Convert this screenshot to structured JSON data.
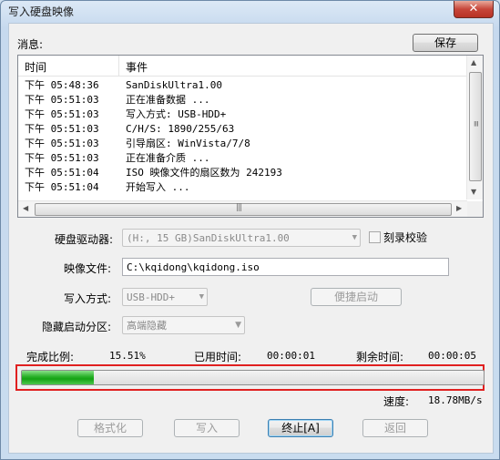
{
  "window": {
    "title": "写入硬盘映像",
    "close_glyph": "✕"
  },
  "log": {
    "label": "消息:",
    "save_label": "保存",
    "columns": [
      "时间",
      "事件"
    ],
    "rows": [
      {
        "time": "下午 05:48:36",
        "event": "SanDiskUltra1.00"
      },
      {
        "time": "下午 05:51:03",
        "event": "正在准备数据 ..."
      },
      {
        "time": "下午 05:51:03",
        "event": "写入方式: USB-HDD+"
      },
      {
        "time": "下午 05:51:03",
        "event": "C/H/S: 1890/255/63"
      },
      {
        "time": "下午 05:51:03",
        "event": "引导扇区: WinVista/7/8"
      },
      {
        "time": "下午 05:51:03",
        "event": "正在准备介质 ..."
      },
      {
        "time": "下午 05:51:04",
        "event": "ISO 映像文件的扇区数为 242193"
      },
      {
        "time": "下午 05:51:04",
        "event": "开始写入 ..."
      }
    ]
  },
  "form": {
    "drive_label": "硬盘驱动器:",
    "drive_value": "(H:, 15 GB)SanDiskUltra1.00",
    "verify_label": "刻录校验",
    "image_label": "映像文件:",
    "image_value": "C:\\kqidong\\kqidong.iso",
    "write_mode_label": "写入方式:",
    "write_mode_value": "USB-HDD+",
    "quick_boot_label": "便捷启动",
    "hidden_part_label": "隐藏启动分区:",
    "hidden_part_value": "高端隐藏"
  },
  "progress": {
    "percent_label": "完成比例:",
    "percent_value": "15.51%",
    "fraction": 0.1551,
    "elapsed_label": "已用时间:",
    "elapsed_value": "00:00:01",
    "remaining_label": "剩余时间:",
    "remaining_value": "00:00:05",
    "speed_label": "速度:",
    "speed_value": "18.78MB/s",
    "highlight_color": "#e02020",
    "fill_color": "#14a214"
  },
  "buttons": {
    "format": "格式化",
    "write": "写入",
    "abort": "终止[A]",
    "back": "返回"
  }
}
